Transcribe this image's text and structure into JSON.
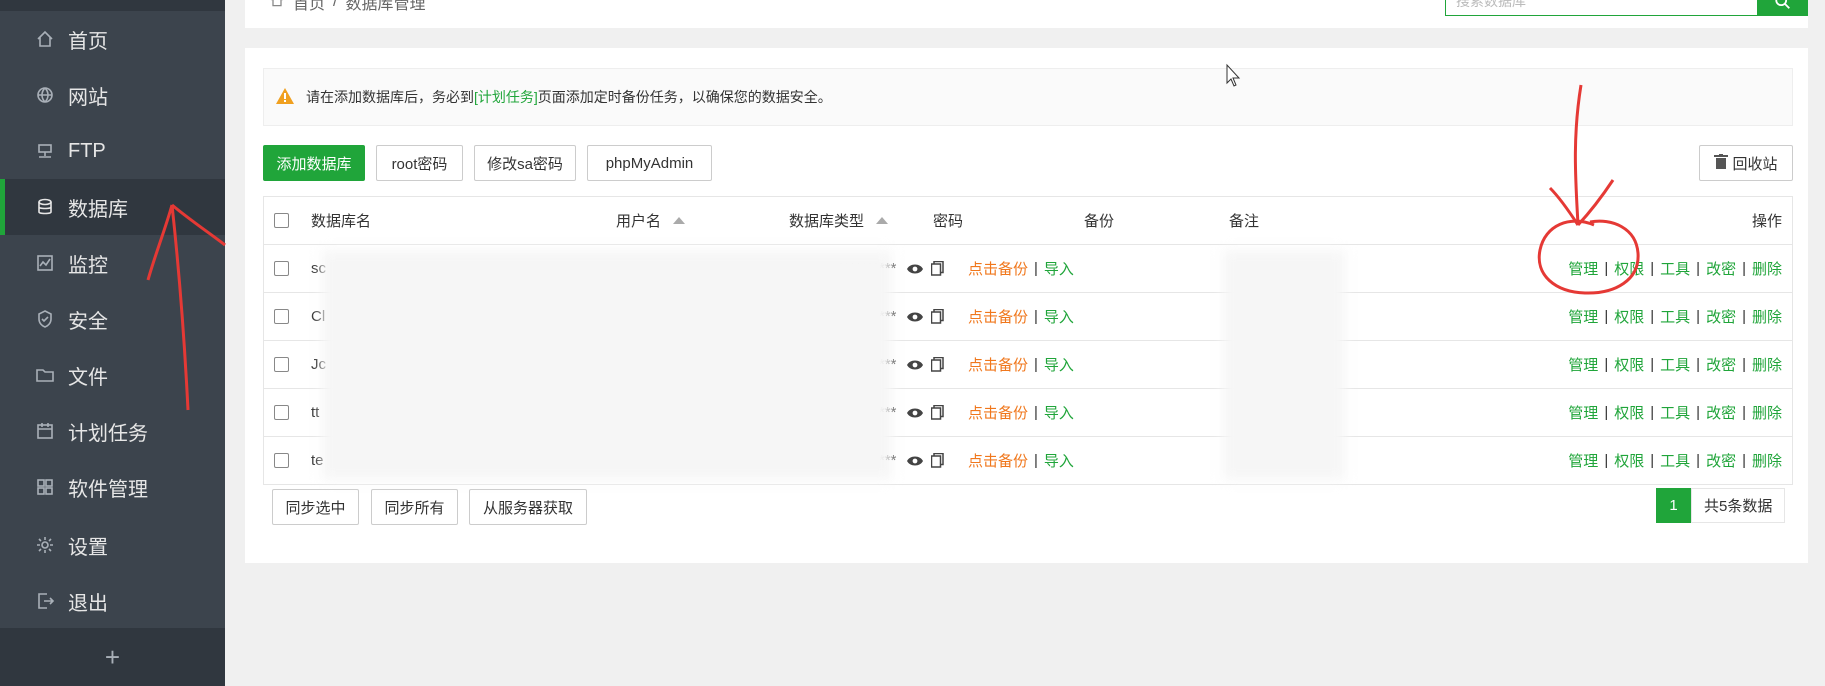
{
  "sidebar": {
    "items": [
      {
        "label": "首页",
        "icon": "home-icon"
      },
      {
        "label": "网站",
        "icon": "globe-icon"
      },
      {
        "label": "FTP",
        "icon": "ftp-icon"
      },
      {
        "label": "数据库",
        "icon": "database-icon"
      },
      {
        "label": "监控",
        "icon": "monitor-icon"
      },
      {
        "label": "安全",
        "icon": "shield-icon"
      },
      {
        "label": "文件",
        "icon": "folder-icon"
      },
      {
        "label": "计划任务",
        "icon": "calendar-icon"
      },
      {
        "label": "软件管理",
        "icon": "apps-icon"
      },
      {
        "label": "设置",
        "icon": "gear-icon"
      },
      {
        "label": "退出",
        "icon": "logout-icon"
      }
    ],
    "active_index": 3,
    "add_label": "+"
  },
  "header": {
    "breadcrumb_home": "首页",
    "breadcrumb_sep": "/",
    "breadcrumb_current": "数据库管理",
    "search_placeholder": "搜索数据库"
  },
  "tip": {
    "prefix": "请在添加数据库后，务必到",
    "link": "[计划任务]",
    "suffix": "页面添加定时备份任务，以确保您的数据安全。"
  },
  "toolbar": {
    "add_db": "添加数据库",
    "root_pwd": "root密码",
    "sa_pwd": "修改sa密码",
    "phpmyadmin": "phpMyAdmin",
    "recycle": "回收站"
  },
  "table": {
    "headers": {
      "name": "数据库名",
      "user": "用户名",
      "type": "数据库类型",
      "password": "密码",
      "backup": "备份",
      "note": "备注",
      "actions": "操作"
    },
    "rows": [
      {
        "name": "sc",
        "password": "**********",
        "backup": "点击备份",
        "import": "导入"
      },
      {
        "name": "Cl",
        "password": "**********",
        "backup": "点击备份",
        "import": "导入"
      },
      {
        "name": "Jc",
        "password": "**********",
        "backup": "点击备份",
        "import": "导入"
      },
      {
        "name": "tt",
        "password": "**********",
        "backup": "点击备份",
        "import": "导入"
      },
      {
        "name": "te",
        "password": "**********",
        "backup": "点击备份",
        "import": "导入"
      }
    ],
    "actions": [
      "管理",
      "权限",
      "工具",
      "改密",
      "删除"
    ],
    "separator": "|"
  },
  "footer": {
    "sync_selected": "同步选中",
    "sync_all": "同步所有",
    "fetch_server": "从服务器获取",
    "page": "1",
    "total": "共5条数据"
  },
  "colors": {
    "accent": "#20a53a",
    "sidebar_bg": "#3c444d",
    "backup_link": "#f0771c",
    "annotation": "#e53935"
  }
}
